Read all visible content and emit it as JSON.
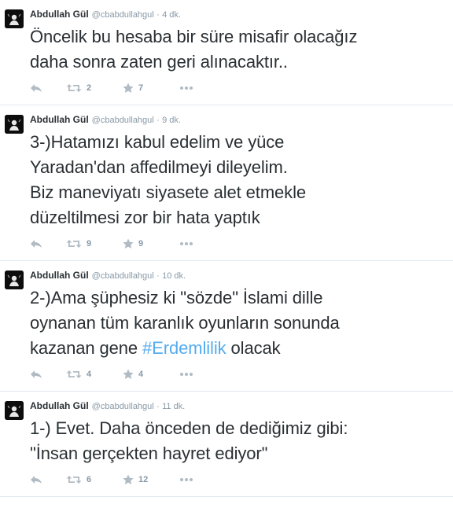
{
  "tweets": [
    {
      "fullname": "Abdullah Gül",
      "username": "@cbabdullahgul",
      "separator": "·",
      "time": "4 dk.",
      "text_before": "Öncelik bu hesaba bir süre misafir olacağız\ndaha sonra zaten geri alınacaktır..",
      "hashtag": "",
      "text_after": "",
      "retweets": "2",
      "favorites": "7"
    },
    {
      "fullname": "Abdullah Gül",
      "username": "@cbabdullahgul",
      "separator": "·",
      "time": "9 dk.",
      "text_before": "3-)Hatamızı kabul edelim ve yüce\nYaradan'dan affedilmeyi dileyelim.\nBiz maneviyatı siyasete alet etmekle\ndüzeltilmesi zor bir hata yaptık",
      "hashtag": "",
      "text_after": "",
      "retweets": "9",
      "favorites": "9"
    },
    {
      "fullname": "Abdullah Gül",
      "username": "@cbabdullahgul",
      "separator": "·",
      "time": "10 dk.",
      "text_before": "2-)Ama şüphesiz ki \"sözde\" İslami dille\noynanan tüm karanlık oyunların sonunda\nkazanan gene ",
      "hashtag": "#Erdemlilik",
      "text_after": " olacak",
      "retweets": "4",
      "favorites": "4"
    },
    {
      "fullname": "Abdullah Gül",
      "username": "@cbabdullahgul",
      "separator": "·",
      "time": "11 dk.",
      "text_before": "1-) Evet. Daha önceden de dediğimiz gibi:\n\"İnsan gerçekten hayret ediyor\"",
      "hashtag": "",
      "text_after": "",
      "retweets": "6",
      "favorites": "12"
    }
  ],
  "icons": {
    "reply": "reply-icon",
    "retweet": "retweet-icon",
    "favorite": "star-icon",
    "more": "more-icon"
  },
  "colors": {
    "text": "#292f33",
    "secondary": "#8899a6",
    "hashtag": "#55acee",
    "action_icon": "#b1bbc3",
    "divider": "#e1e8ed"
  }
}
